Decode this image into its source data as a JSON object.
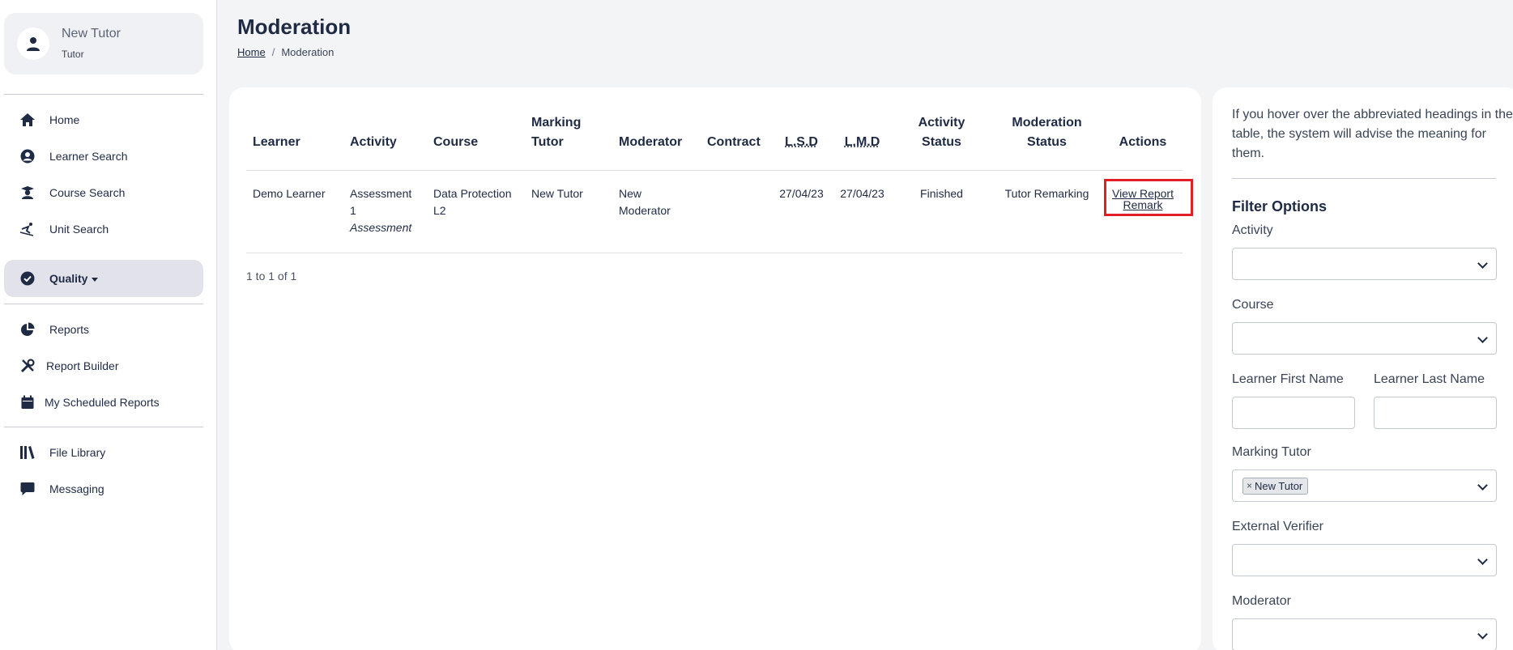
{
  "user": {
    "name": "New Tutor",
    "role": "Tutor"
  },
  "nav": {
    "home": "Home",
    "learner_search": "Learner Search",
    "course_search": "Course Search",
    "unit_search": "Unit Search",
    "quality": "Quality",
    "reports": "Reports",
    "report_builder": "Report Builder",
    "scheduled_reports": "My Scheduled Reports",
    "file_library": "File Library",
    "messaging": "Messaging"
  },
  "header": {
    "title": "Moderation",
    "breadcrumb": {
      "home": "Home",
      "sep": "/",
      "current": "Moderation"
    }
  },
  "table": {
    "headers": {
      "learner": "Learner",
      "activity": "Activity",
      "course": "Course",
      "marking_tutor_1": "Marking",
      "marking_tutor_2": "Tutor",
      "moderator": "Moderator",
      "contract": "Contract",
      "lsd": "L.S.D",
      "lmd": "L.M.D",
      "activity_status": "Activity Status",
      "moderation_status": "Moderation Status",
      "actions": "Actions"
    },
    "rows": [
      {
        "learner": "Demo Learner",
        "activity_1": "Assessment",
        "activity_2": "1",
        "activity_type": "Assessment",
        "course_1": "Data Protection",
        "course_2": "L2",
        "marking_tutor": "New Tutor",
        "moderator_1": "New",
        "moderator_2": "Moderator",
        "contract": "",
        "lsd": "27/04/23",
        "lmd": "27/04/23",
        "activity_status": "Finished",
        "moderation_status": "Tutor Remarking",
        "action_view": "View Report",
        "action_remark": "Remark"
      }
    ],
    "pager": "1 to 1 of 1"
  },
  "filters": {
    "hint": "If you hover over the abbreviated headings in the table, the system will advise the meaning for them.",
    "title": "Filter Options",
    "activity_label": "Activity",
    "course_label": "Course",
    "first_name_label": "Learner First Name",
    "last_name_label": "Learner Last Name",
    "marking_tutor_label": "Marking Tutor",
    "marking_tutor_chip": "New Tutor",
    "chip_remove": "×",
    "external_verifier_label": "External Verifier",
    "moderator_label": "Moderator"
  }
}
